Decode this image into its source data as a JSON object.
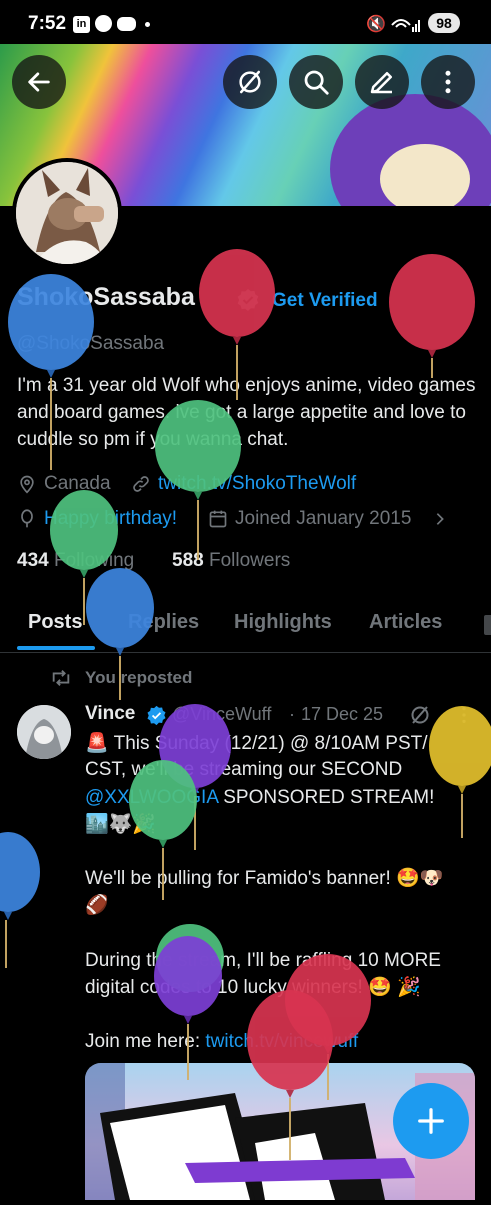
{
  "status_bar": {
    "time": "7:52",
    "battery": "98",
    "notification_icons": [
      "linkedin-icon",
      "facebook-icon",
      "discord-icon"
    ]
  },
  "header": {
    "back_icon": "arrow-left-icon",
    "action_icons": [
      "circle-slash-icon",
      "search-icon",
      "edit-icon",
      "more-vertical-icon"
    ]
  },
  "profile": {
    "display_name": "ShokoSassaba",
    "verify_link": "Get Verified",
    "handle": "@ShokoSassaba",
    "bio": "I'm a 31 year old Wolf who enjoys anime, video games and board games. ive got a large appetite and love to cuddle so pm if you wanna chat.",
    "location": "Canada",
    "website": "twitch.tv/ShokoTheWolf",
    "birthday": "Happy birthday!",
    "joined": "Joined January 2015",
    "following_count": "434",
    "following_label": "Following",
    "followers_count": "588",
    "followers_label": "Followers"
  },
  "tabs": [
    "Posts",
    "Replies",
    "Highlights",
    "Articles"
  ],
  "active_tab": "Posts",
  "post": {
    "repost_label": "You reposted",
    "author_name": "Vince",
    "author_handle": "@VinceWuff",
    "date": "17 Dec 25",
    "line1": "🚨 This Sunday (12/21) @ 8/10AM PST/",
    "line2": "CST, we'll be streaming our SECOND",
    "mention": "@XXLWOOGIA",
    "line3_rest": " SPONSORED STREAM!",
    "line4": "🏙️🐺🎉",
    "para2_line1": "We'll be pulling for Famido's banner! 🤩🐶",
    "para2_line2": "🏈",
    "para3_line1": "During the stream, I'll be raffling 10 MORE",
    "para3_line2": "digital codes to 10 lucky winners! 🤩 🎉",
    "para4_prefix": "Join me here: ",
    "para4_link": "twitch.tv/vincewuff"
  },
  "fab_icon": "plus-icon",
  "colors": {
    "accent_blue": "#1d9bf0",
    "muted_gray": "#71767b",
    "text": "#e7e9ea",
    "background": "#000000"
  }
}
